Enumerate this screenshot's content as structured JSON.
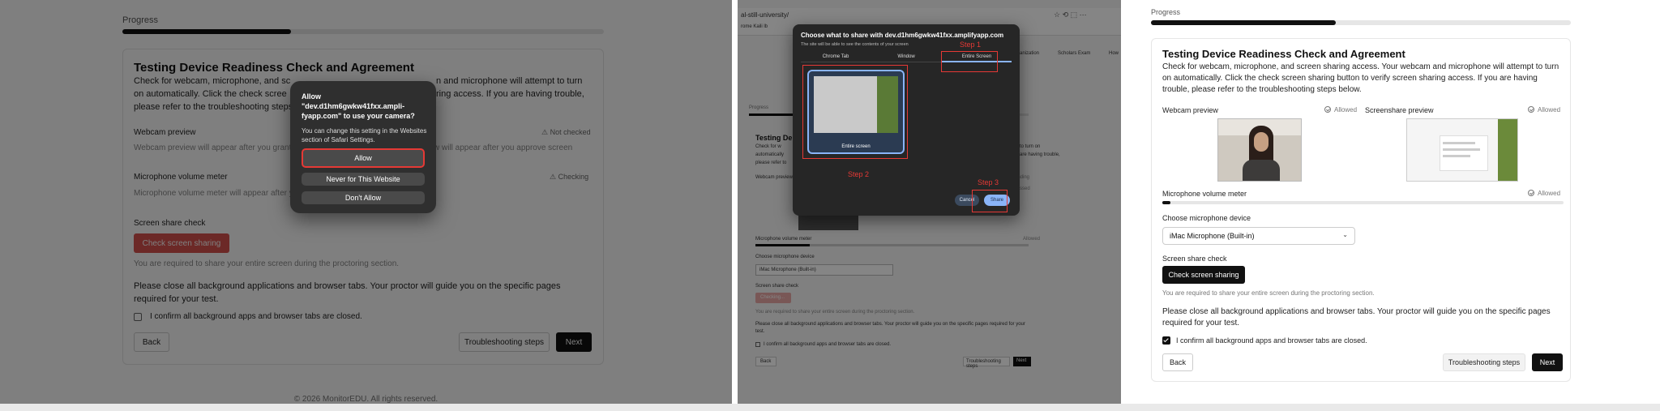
{
  "panel1": {
    "progress_label": "Progress",
    "progress_fraction": 0.35,
    "title": "Testing Device Readiness Check and Agreement",
    "intro_left": "Check for webcam, microphone, and sc",
    "intro_right_1": "n and microphone will attempt to turn",
    "intro_line2_left": "on automatically. Click the check scree",
    "intro_line2_right": "ring access. If you are having trouble,",
    "intro_line3": "please refer to the troubleshooting steps",
    "webcam_label": "Webcam preview",
    "webcam_status": "Not checked",
    "webcam_muted": "Webcam preview will appear after you grant",
    "screen_muted": "w will appear after you approve screen",
    "mic_label": "Microphone volume meter",
    "mic_status": "Checking",
    "mic_muted": "Microphone volume meter will appear after y",
    "screen_check_label": "Screen share check",
    "screen_check_button": "Check screen sharing",
    "screen_required": "You are required to share your entire screen during the proctoring section.",
    "close_message": "Please close all background applications and browser tabs. Your proctor will guide you on the specific pages required for your test.",
    "confirm_label": "I confirm all background apps and browser tabs are closed.",
    "back_button": "Back",
    "troubleshoot_button": "Troubleshooting steps",
    "next_button": "Next",
    "footer": "© 2026 MonitorEDU. All rights reserved.",
    "dialog": {
      "title": "Allow \"dev.d1hm6gwkw41fxx.ampli- fyapp.com\" to use your camera?",
      "text": "You can change this setting in the Websites section of Safari Settings.",
      "allow": "Allow",
      "never": "Never for This Website",
      "dont": "Don't Allow"
    }
  },
  "panel2": {
    "url": "al-still-university/",
    "bookmarks": "rome   Kaili   lb",
    "nav_organization": "Organization",
    "nav_exam": "Scholars Exam",
    "nav_how": "How",
    "progress_label": "Progress",
    "title": "Testing De",
    "intro": "Check for w",
    "intro2": "automatically",
    "intro3": "please refer to",
    "intro_r1": "to turn on",
    "intro_r2": "are having trouble,",
    "webcam_preview": "Webcam preview",
    "pending": "Pending",
    "screenshot": "ssed",
    "mic_meter": "Microphone volume meter",
    "allowed": "Allowed",
    "choose_mic": "Choose microphone device",
    "mic_value": "iMac Microphone (Built-in)",
    "screen_check": "Screen share check",
    "checking": "Checking...",
    "required": "You are required to share your entire screen during the proctoring section.",
    "close_msg": "Please close all background applications and browser tabs. Your proctor will guide you on the specific pages required for your test.",
    "confirm": "I confirm all background apps and browser tabs are closed.",
    "back": "Back",
    "troubleshoot": "Troubleshooting steps",
    "next": "Next",
    "picker": {
      "title": "Choose what to share with dev.d1hm6gwkw41fxx.amplifyapp.com",
      "subtitle": "The site will be able to see the contents of your screen",
      "tab_chrome": "Chrome Tab",
      "tab_window": "Window",
      "tab_entire": "Entire Screen",
      "thumb_caption": "Entire screen",
      "cancel": "Cancel",
      "share": "Share",
      "step1": "Step 1",
      "step2": "Step 2",
      "step3": "Step 3"
    }
  },
  "panel3": {
    "progress_label": "Progress",
    "progress_fraction": 0.44,
    "title": "Testing Device Readiness Check and Agreement",
    "intro": "Check for webcam, microphone, and screen sharing access. Your webcam and microphone will attempt to turn on automatically. Click the check screen sharing button to verify screen sharing access. If you are having trouble, please refer to the troubleshooting steps below.",
    "webcam_label": "Webcam preview",
    "webcam_status": "Allowed",
    "screenshare_label": "Screenshare preview",
    "screenshare_status": "Allowed",
    "mic_label": "Microphone volume meter",
    "mic_status": "Allowed",
    "mic_level": 0.02,
    "choose_mic_label": "Choose microphone device",
    "mic_value": "iMac Microphone (Built-in)",
    "screen_check_label": "Screen share check",
    "screen_check_button": "Check screen sharing",
    "screen_required": "You are required to share your entire screen during the proctoring section.",
    "close_message": "Please close all background applications and browser tabs. Your proctor will guide you on the specific pages required for your test.",
    "confirm_label": "I confirm all background apps and browser tabs are closed.",
    "back_button": "Back",
    "troubleshoot_button": "Troubleshooting steps",
    "next_button": "Next"
  },
  "colors": {
    "accent_red": "#e53935",
    "dark": "#111111",
    "picker_blue": "#8ab4f8"
  }
}
